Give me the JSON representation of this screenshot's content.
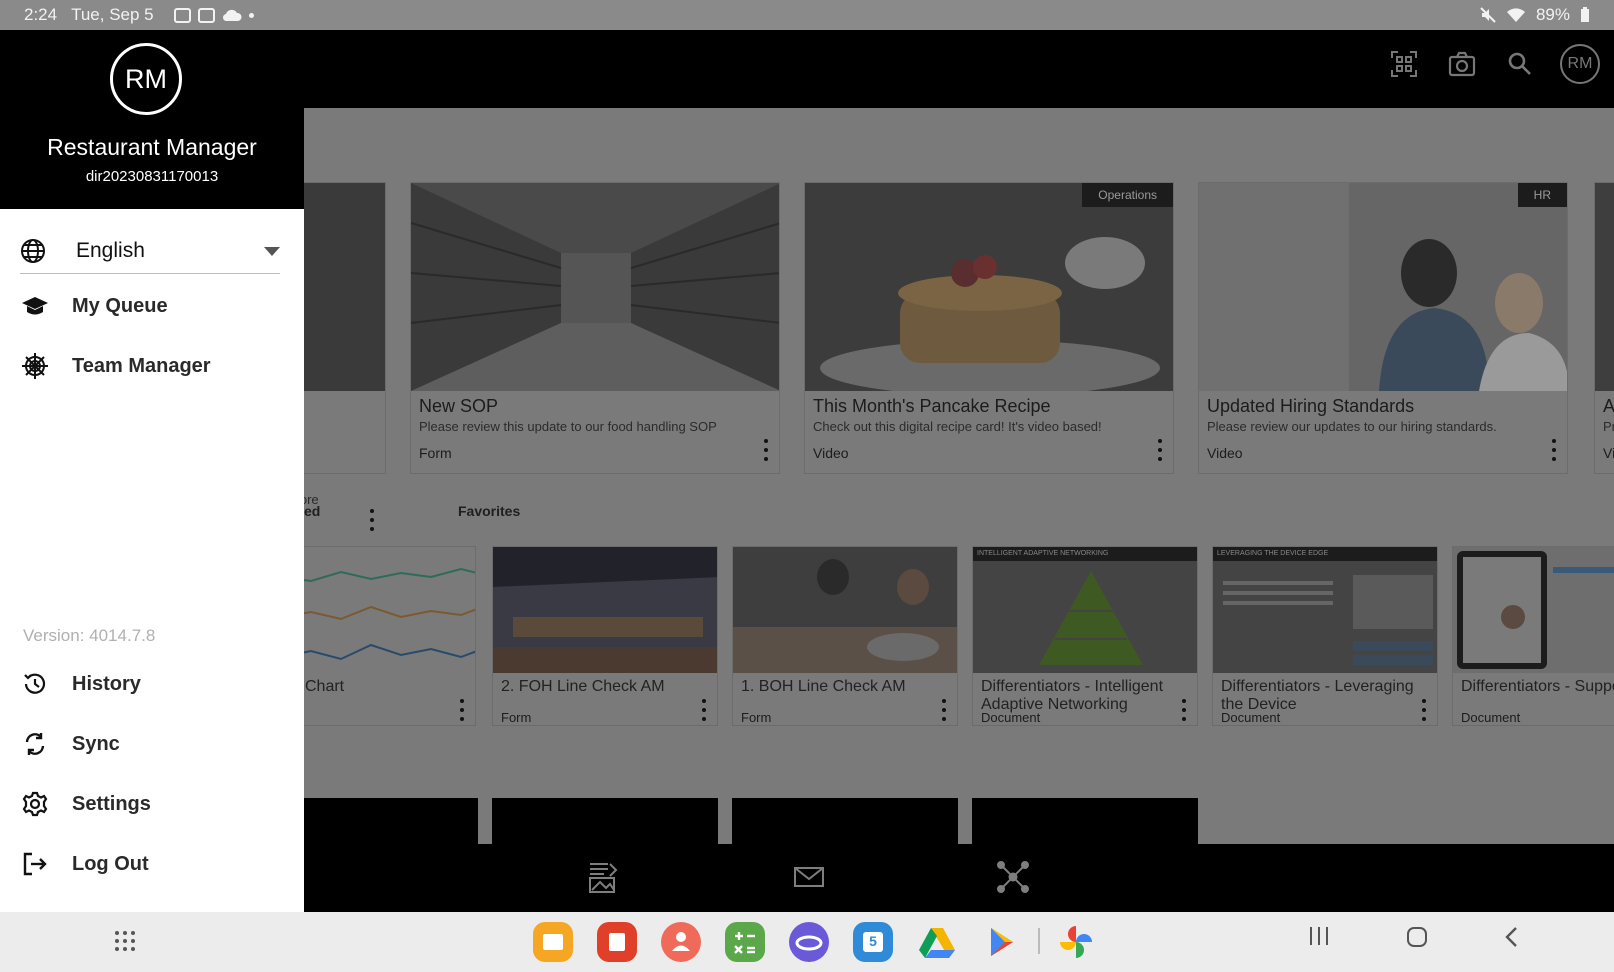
{
  "status_bar": {
    "time": "2:24",
    "date": "Tue, Sep 5",
    "battery": "89%"
  },
  "header_actions": {
    "avatar_initials": "RM"
  },
  "drawer": {
    "avatar_initials": "RM",
    "user_name": "Restaurant Manager",
    "user_id": "dir20230831170013",
    "language": "English",
    "menu_top": [
      {
        "label": "My Queue",
        "icon": "graduation-cap-icon"
      },
      {
        "label": "Team Manager",
        "icon": "team-hub-icon"
      }
    ],
    "version": "Version: 4014.7.8",
    "menu_bottom": [
      {
        "label": "History",
        "icon": "history-icon"
      },
      {
        "label": "Sync",
        "icon": "sync-icon"
      },
      {
        "label": "Settings",
        "icon": "gear-icon"
      },
      {
        "label": "Log Out",
        "icon": "logout-icon"
      }
    ]
  },
  "featured": [
    {
      "title": "",
      "description": "efore",
      "type": "",
      "tag": ""
    },
    {
      "title": "New SOP",
      "description": "Please review this update to our food handling SOP",
      "type": "Form",
      "tag": ""
    },
    {
      "title": "This Month's Pancake Recipe",
      "description": "Check out this digital recipe card! It's video based!",
      "type": "Video",
      "tag": "Operations"
    },
    {
      "title": "Updated Hiring Standards",
      "description": "Please review our updates to our hiring standards.",
      "type": "Video",
      "tag": "HR"
    },
    {
      "title": "A",
      "description": "Pr",
      "type": "Vi",
      "tag": ""
    }
  ],
  "section_labels": {
    "partial": "ed",
    "favorites": "Favorites"
  },
  "favorites": [
    {
      "title": "Chart",
      "type": ""
    },
    {
      "title": "2. FOH Line Check AM",
      "type": "Form"
    },
    {
      "title": "1. BOH Line Check AM",
      "type": "Form"
    },
    {
      "title": "Differentiators - Intelligent Adaptive Networking",
      "type": "Document"
    },
    {
      "title": "Differentiators - Leveraging the Device",
      "type": "Document"
    },
    {
      "title": "Differentiators - Suppo for xAPI files",
      "type": "Document"
    }
  ],
  "thumb_text": {
    "networking": "INTELLIGENT ADAPTIVE NETWORKING",
    "device_edge": "LEVERAGING THE DEVICE EDGE"
  },
  "dock": [
    {
      "name": "my-files-app",
      "color": "#f5a623"
    },
    {
      "name": "notes-app",
      "color": "#e0402a"
    },
    {
      "name": "contacts-app",
      "color": "#f06a5a"
    },
    {
      "name": "calculator-app",
      "color": "#5aa84a"
    },
    {
      "name": "internet-app",
      "color": "#6a5ad8"
    },
    {
      "name": "calendar-app",
      "color": "#2f8ad8"
    },
    {
      "name": "drive-app",
      "color": "#ececec"
    },
    {
      "name": "play-store-app",
      "color": "#ececec"
    },
    {
      "name": "photos-app",
      "color": "#ececec"
    }
  ],
  "calendar_day": "5"
}
